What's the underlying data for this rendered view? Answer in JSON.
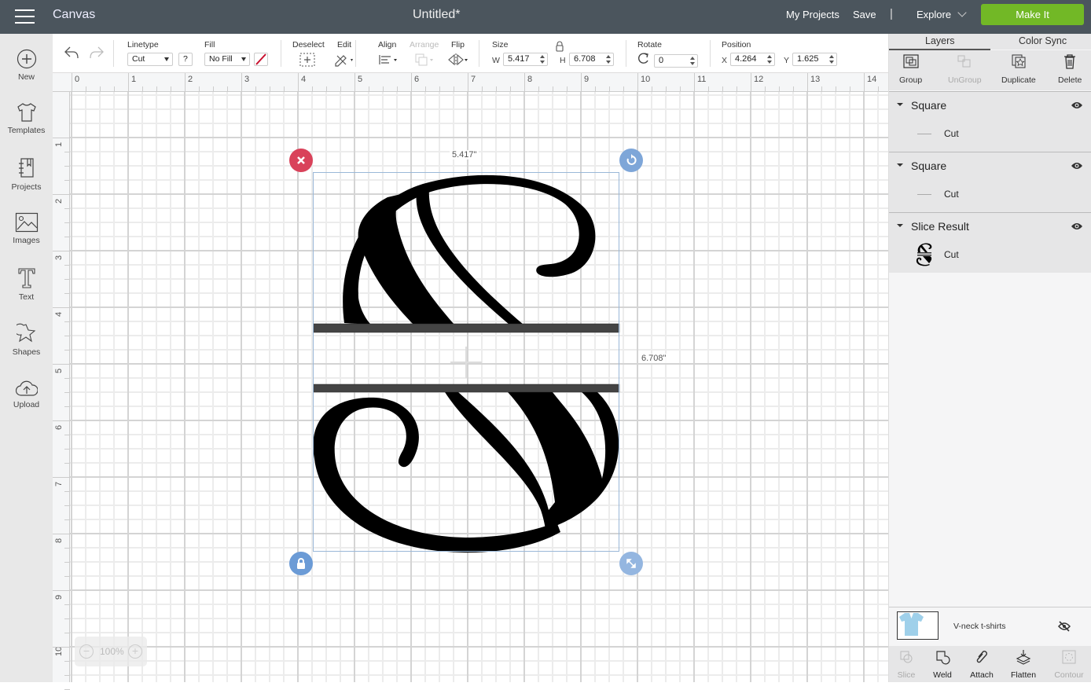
{
  "topbar": {
    "app_name": "Canvas",
    "doc_title": "Untitled*",
    "my_projects": "My Projects",
    "save": "Save",
    "separator": "|",
    "explore": "Explore",
    "make_it": "Make It",
    "make_it_color": "#72b826"
  },
  "leftbar": {
    "items": [
      {
        "label": "New",
        "icon": "plus-circle-icon"
      },
      {
        "label": "Templates",
        "icon": "tshirt-icon"
      },
      {
        "label": "Projects",
        "icon": "notebook-icon"
      },
      {
        "label": "Images",
        "icon": "image-icon"
      },
      {
        "label": "Text",
        "icon": "text-t-icon"
      },
      {
        "label": "Shapes",
        "icon": "shapes-icon"
      },
      {
        "label": "Upload",
        "icon": "cloud-upload-icon"
      }
    ]
  },
  "toolbar": {
    "linetype_label": "Linetype",
    "linetype_value": "Cut",
    "help": "?",
    "fill_label": "Fill",
    "fill_value": "No Fill",
    "deselect_label": "Deselect",
    "edit_label": "Edit",
    "align_label": "Align",
    "arrange_label": "Arrange",
    "flip_label": "Flip",
    "size_label": "Size",
    "w_label": "W",
    "w_value": "5.417",
    "h_label": "H",
    "h_value": "6.708",
    "rotate_label": "Rotate",
    "rotate_value": "0",
    "position_label": "Position",
    "x_label": "X",
    "x_value": "4.264",
    "y_label": "Y",
    "y_value": "1.625",
    "pen_color": "#c8102e"
  },
  "rulers": {
    "top": [
      "0",
      "1",
      "2",
      "3",
      "4",
      "5",
      "6",
      "7",
      "8",
      "9",
      "10",
      "11",
      "12",
      "13",
      "14"
    ],
    "left": [
      "1",
      "2",
      "3",
      "4",
      "5",
      "6",
      "7",
      "8",
      "9",
      "10"
    ]
  },
  "canvas": {
    "width_label": "5.417\"",
    "height_label": "6.708\"",
    "zoom_value": "100%",
    "zoom_minus": "−",
    "zoom_plus": "+",
    "delete_handle_color": "#d9425a",
    "handle_color": "#7ea6d8"
  },
  "right_panel": {
    "tabs": [
      "Layers",
      "Color Sync"
    ],
    "actions": [
      {
        "label": "Group",
        "enabled": true
      },
      {
        "label": "UnGroup",
        "enabled": false
      },
      {
        "label": "Duplicate",
        "enabled": true
      },
      {
        "label": "Delete",
        "enabled": true
      }
    ],
    "layers": [
      {
        "name": "Square",
        "sub": "Cut"
      },
      {
        "name": "Square",
        "sub": "Cut"
      },
      {
        "name": "Slice Result",
        "sub": "Cut"
      }
    ],
    "mat": {
      "name": "V-neck t-shirts",
      "shirt_color": "#9fd0ea"
    },
    "bottom_actions": [
      {
        "label": "Slice",
        "enabled": false
      },
      {
        "label": "Weld",
        "enabled": true
      },
      {
        "label": "Attach",
        "enabled": true
      },
      {
        "label": "Flatten",
        "enabled": true
      },
      {
        "label": "Contour",
        "enabled": false
      }
    ]
  }
}
